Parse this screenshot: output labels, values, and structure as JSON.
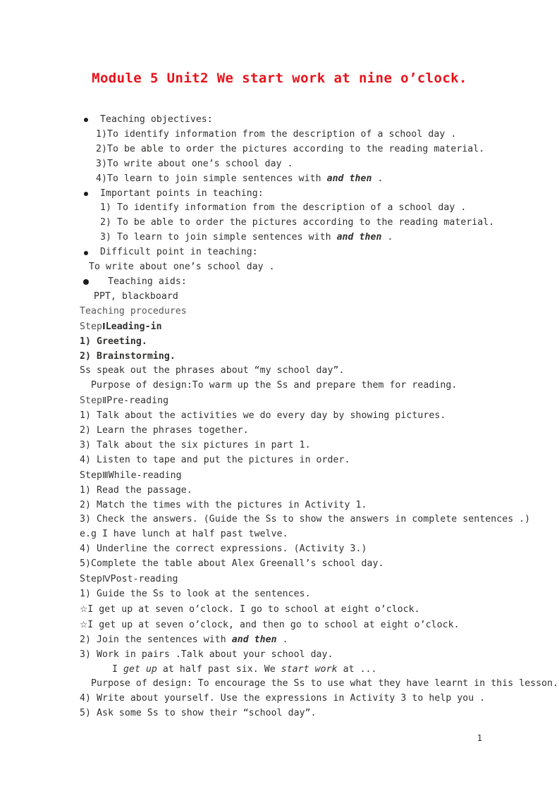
{
  "document": {
    "title": "Module 5 Unit2 We start work at nine o’clock.",
    "title_color": "#e8121a",
    "page_number": "1"
  },
  "sections": {
    "objectives": {
      "heading": "Teaching objectives:",
      "items": [
        "1)To identify information from the description of a school day .",
        "2)To be able to order the pictures according to the reading material.",
        "3)To write about one’s school day .",
        {
          "prefix": "4)To learn to join simple sentences with ",
          "emphasis": "and then",
          "suffix": " ."
        }
      ]
    },
    "important_points": {
      "heading": "Important points in teaching:",
      "items": [
        "1)  To identify information from the description of a school day .",
        "2)  To be able to order the pictures according to the reading material.",
        {
          "prefix": "3)  To learn to join simple sentences with ",
          "emphasis": "and then",
          "suffix": " ."
        }
      ]
    },
    "difficult_point": {
      "heading": "Difficult point in teaching:",
      "body": "To write about one’s school day ."
    },
    "teaching_aids": {
      "heading": "Teaching aids:",
      "body": "PPT, blackboard"
    },
    "procedures": {
      "heading": "Teaching procedures",
      "step1": {
        "step_label": "Step",
        "numeral": "Ⅰ",
        "name": "Leading-in",
        "items": [
          "1)  Greeting.",
          "2)  Brainstorming."
        ],
        "note": "Ss speak out the phrases about “my school day”.",
        "purpose": "Purpose of design:To warm up the Ss and prepare them for reading."
      },
      "step2": {
        "step_label": "Step",
        "numeral": "Ⅱ",
        "name": "Pre-reading",
        "items": [
          "1)  Talk about the activities we do every day by showing pictures.",
          "2)  Learn the phrases together.",
          "3)  Talk about the six pictures in part 1.",
          "4)  Listen to tape and put the pictures in order."
        ]
      },
      "step3": {
        "step_label": "Step",
        "numeral": "Ⅲ",
        "name": "While-reading",
        "items": [
          "1)  Read the passage.",
          "2)  Match the times with the pictures in Activity 1.",
          "3)  Check the answers. (Guide the Ss to show the answers in complete sentences .)",
          "e.g I have lunch at half past twelve.",
          "4) Underline the correct expressions. (Activity 3.)",
          "5)Complete the table about Alex Greenall’s school day."
        ]
      },
      "step4": {
        "step_label": "Step",
        "numeral": "Ⅳ",
        "name": "Post-reading",
        "item1": "1)  Guide the Ss to look at the sentences.",
        "star_symbol": "☆",
        "star_line1": "I get up at seven o’clock.  I go to school at eight o’clock.",
        "star_line2": "I get up at seven o’clock, and then go to school at eight o’clock.",
        "item2": {
          "prefix": "2)  Join the sentences with ",
          "emphasis": "and then",
          "suffix": " ."
        },
        "item3": "3)  Work in pairs .Talk about your school day.",
        "example": {
          "p1": "I ",
          "em1": "get up",
          "p2": " at half past six. We ",
          "em2": "start work",
          "p3": " at ..."
        },
        "purpose": "Purpose of design: To encourage the Ss to use what they have learnt in this lesson.",
        "item4": "4)  Write about yourself. Use the expressions in Activity 3 to help you .",
        "item5": "5)  Ask some Ss to show their “school day”."
      }
    }
  }
}
